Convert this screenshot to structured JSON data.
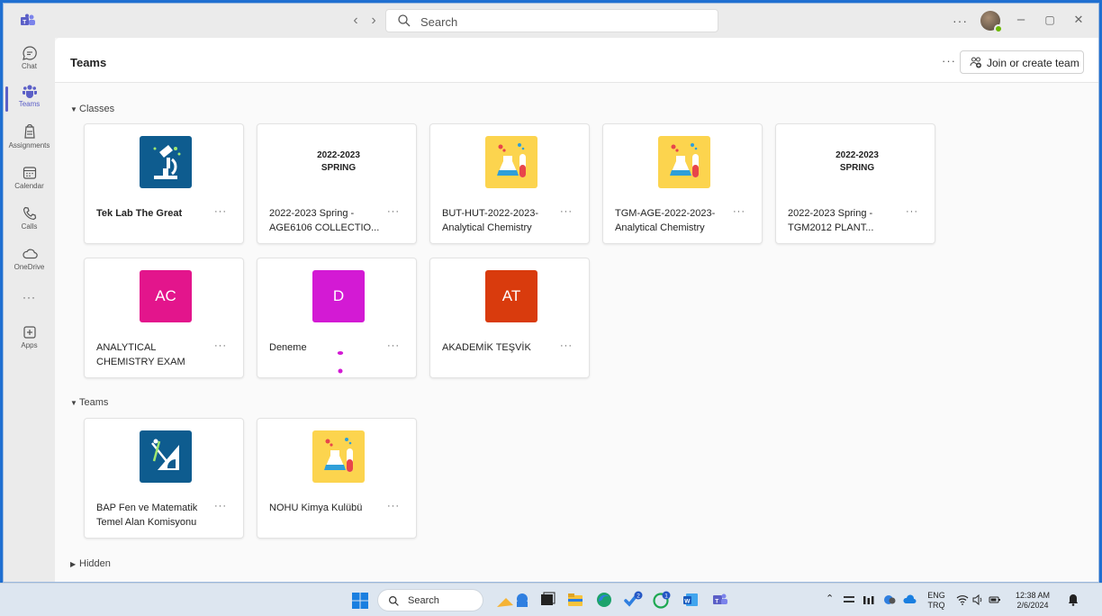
{
  "titlebar": {
    "search_placeholder": "Search",
    "more_label": "···",
    "back_icon": "chevron-left-icon",
    "forward_icon": "chevron-right-icon",
    "minimize": "–",
    "maximize": "▢",
    "close": "✕"
  },
  "rail": {
    "items": [
      {
        "label": "Chat",
        "icon": "chat-icon"
      },
      {
        "label": "Teams",
        "icon": "teams-icon",
        "active": true
      },
      {
        "label": "Assignments",
        "icon": "assignments-icon"
      },
      {
        "label": "Calendar",
        "icon": "calendar-icon"
      },
      {
        "label": "Calls",
        "icon": "calls-icon"
      },
      {
        "label": "OneDrive",
        "icon": "onedrive-icon"
      },
      {
        "label": "···",
        "icon": "more-apps-icon"
      },
      {
        "label": "Apps",
        "icon": "apps-icon"
      }
    ]
  },
  "header": {
    "title": "Teams",
    "more_label": "···",
    "join_label": "Join or create team"
  },
  "sections": {
    "classes": "Classes",
    "teams": "Teams",
    "hidden": "Hidden"
  },
  "cards": {
    "more_label": "···",
    "classes": [
      {
        "name": "Tek Lab The Great",
        "image": "microscope-icon",
        "bg": "#0e5c8f"
      },
      {
        "name": "2022-2023 Spring - AGE6106 COLLECTIO...",
        "image": "text",
        "line1": "2022-2023",
        "line2": "SPRING"
      },
      {
        "name": "BUT-HUT-2022-2023-Analytical Chemistry",
        "image": "flask-icon",
        "bg": "#fcd44e"
      },
      {
        "name": "TGM-AGE-2022-2023-Analytical Chemistry",
        "image": "flask-icon",
        "bg": "#fcd44e"
      },
      {
        "name": "2022-2023 Spring - TGM2012 PLANT...",
        "image": "text",
        "line1": "2022-2023",
        "line2": "SPRING"
      },
      {
        "name": "ANALYTICAL CHEMISTRY EXAM",
        "image": "initials",
        "initials": "AC",
        "bg": "#e3158c"
      },
      {
        "name": "Deneme",
        "image": "initials",
        "initials": "D",
        "bg": "#d31ad4"
      },
      {
        "name": "AKADEMİK TEŞVİK",
        "image": "initials",
        "initials": "AT",
        "bg": "#d93b0d"
      }
    ],
    "teams": [
      {
        "name": "BAP Fen ve Matematik Temel Alan Komisyonu",
        "image": "geometry-icon",
        "bg": "#0e5c8f"
      },
      {
        "name": "NOHU Kimya Kulübü",
        "image": "flask-icon",
        "bg": "#fcd44e"
      }
    ]
  },
  "taskbar": {
    "search_label": "Search",
    "lang_line1": "ENG",
    "lang_line2": "TRQ",
    "time": "12:38 AM",
    "date": "2/6/2024"
  },
  "colors": {
    "accent": "#5b5fc7",
    "presence": "#6bb700"
  }
}
